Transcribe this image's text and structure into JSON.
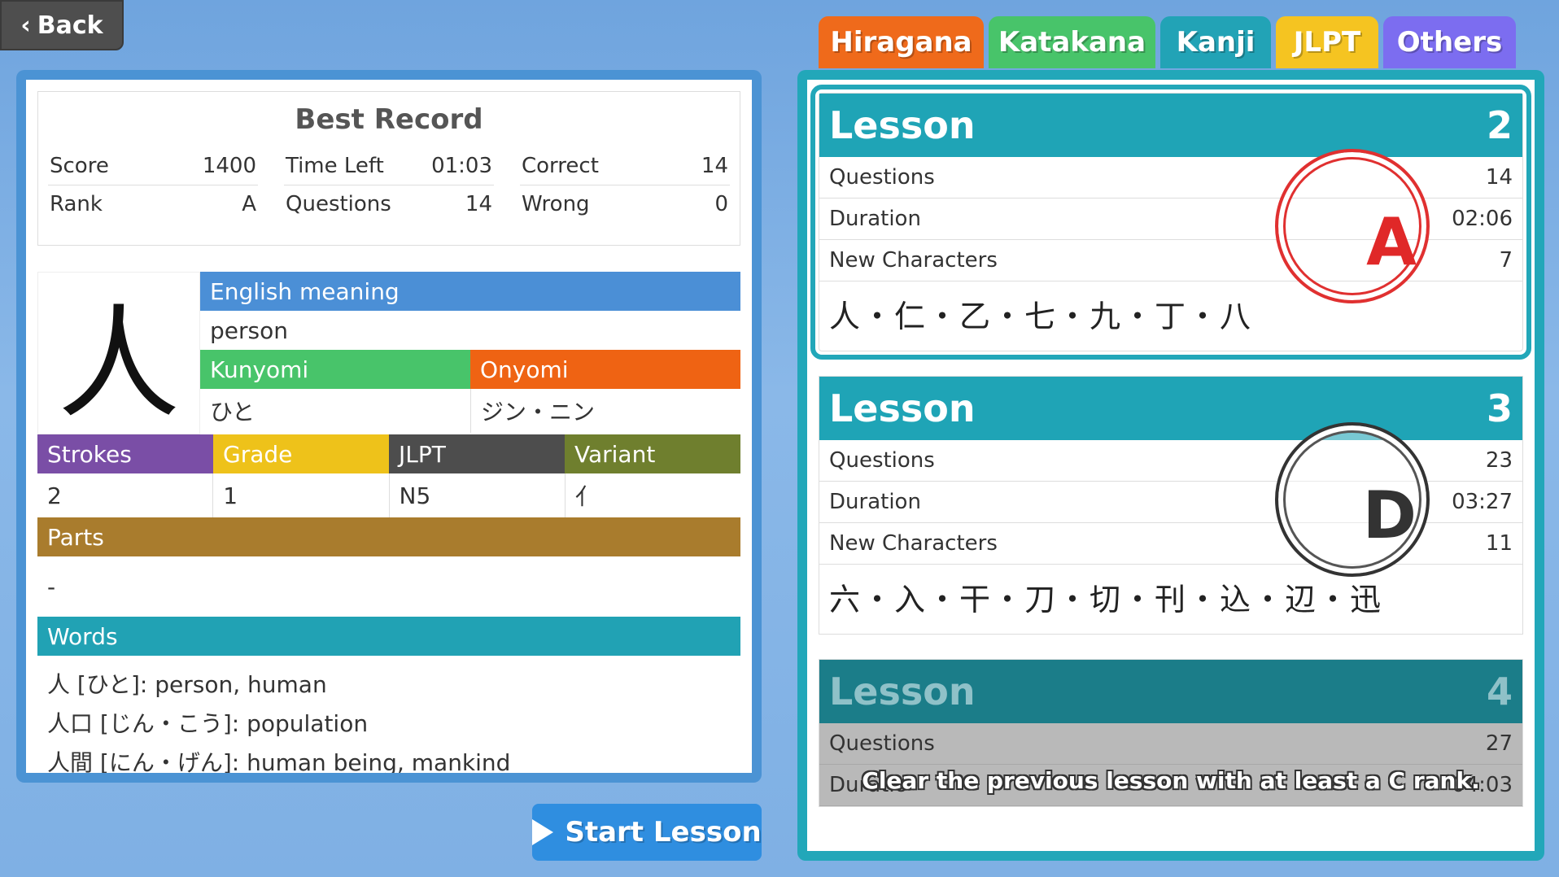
{
  "back": {
    "label": "Back"
  },
  "tabs": [
    {
      "label": "Hiragana"
    },
    {
      "label": "Katakana"
    },
    {
      "label": "Kanji"
    },
    {
      "label": "JLPT"
    },
    {
      "label": "Others"
    }
  ],
  "best_record": {
    "title": "Best Record",
    "score_label": "Score",
    "score": "1400",
    "rank_label": "Rank",
    "rank": "A",
    "time_left_label": "Time Left",
    "time_left": "01:03",
    "questions_label": "Questions",
    "questions": "14",
    "correct_label": "Correct",
    "correct": "14",
    "wrong_label": "Wrong",
    "wrong": "0"
  },
  "kanji": {
    "character": "人",
    "english_meaning_label": "English meaning",
    "english_meaning": "person",
    "kunyomi_label": "Kunyomi",
    "kunyomi": "ひと",
    "onyomi_label": "Onyomi",
    "onyomi": "ジン・ニン",
    "strokes_label": "Strokes",
    "strokes": "2",
    "grade_label": "Grade",
    "grade": "1",
    "jlpt_label": "JLPT",
    "jlpt": "N5",
    "variant_label": "Variant",
    "variant": "亻",
    "parts_label": "Parts",
    "parts": "-",
    "words_label": "Words",
    "words": [
      "人 [ひと]: person, human",
      "人口 [じん・こう]: population",
      "人間 [にん・げん]: human being, mankind"
    ]
  },
  "start_lesson": {
    "label": "Start Lesson"
  },
  "lessons": [
    {
      "title": "Lesson",
      "number": "2",
      "questions_label": "Questions",
      "questions": "14",
      "duration_label": "Duration",
      "duration": "02:06",
      "new_chars_label": "New Characters",
      "new_chars": "7",
      "chars": "人・仁・乙・七・九・丁・八",
      "rank": "A"
    },
    {
      "title": "Lesson",
      "number": "3",
      "questions_label": "Questions",
      "questions": "23",
      "duration_label": "Duration",
      "duration": "03:27",
      "new_chars_label": "New Characters",
      "new_chars": "11",
      "chars": "六・入・干・刀・切・刊・込・辺・迅",
      "rank": "D"
    },
    {
      "title": "Lesson",
      "number": "4",
      "questions_label": "Questions",
      "questions": "27",
      "duration_label": "Duratio",
      "duration": "04:03",
      "locked_message": "Clear the previous lesson with at least a C rank."
    }
  ],
  "colors": {
    "english_meaning": "#4b8fd6",
    "kunyomi": "#48c46a",
    "onyomi": "#ef6313",
    "strokes": "#7a4ea6",
    "grade": "#eec21a",
    "jlpt": "#4d4d4d",
    "variant": "#6f7f2e",
    "parts": "#a97c2d",
    "words": "#21a2b4"
  }
}
